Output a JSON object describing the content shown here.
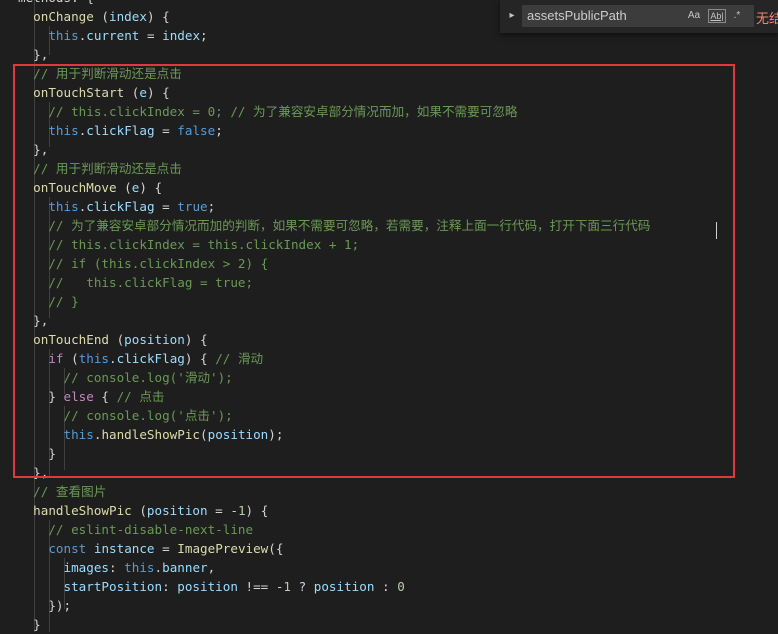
{
  "find_widget": {
    "query": "assetsPublicPath",
    "toggle_icon": "chevron-right-icon",
    "match_case_label": "Aa",
    "whole_word_label": "Ab|",
    "regex_label": ".*",
    "results_text": "无结"
  },
  "colors": {
    "background": "#1e1e1e",
    "highlight_border": "#e0383e",
    "keyword": "#569cd6",
    "function": "#dcdcaa",
    "variable": "#9cdcfe",
    "comment": "#6a9955",
    "string": "#ce9178",
    "number": "#b5cea8"
  },
  "code_lines": [
    [
      [
        "methods: {",
        "pun"
      ]
    ],
    [
      [
        "  ",
        "pun"
      ],
      [
        "onChange",
        "fn"
      ],
      [
        " (",
        "pun"
      ],
      [
        "index",
        "var"
      ],
      [
        ") {",
        "pun"
      ]
    ],
    [
      [
        "    ",
        "pun"
      ],
      [
        "this",
        "kw"
      ],
      [
        ".",
        "pun"
      ],
      [
        "current",
        "prop"
      ],
      [
        " = ",
        "pun"
      ],
      [
        "index",
        "var"
      ],
      [
        ";",
        "pun"
      ]
    ],
    [
      [
        "  },",
        "pun"
      ]
    ],
    [
      [
        "  ",
        "pun"
      ],
      [
        "// 用于判断滑动还是点击",
        "cm"
      ]
    ],
    [
      [
        "  ",
        "pun"
      ],
      [
        "onTouchStart",
        "fn"
      ],
      [
        " (",
        "pun"
      ],
      [
        "e",
        "var"
      ],
      [
        ") {",
        "pun"
      ]
    ],
    [
      [
        "    ",
        "pun"
      ],
      [
        "// this.clickIndex = 0; // 为了兼容安卓部分情况而加，如果不需要可忽略",
        "cm"
      ]
    ],
    [
      [
        "    ",
        "pun"
      ],
      [
        "this",
        "kw"
      ],
      [
        ".",
        "pun"
      ],
      [
        "clickFlag",
        "prop"
      ],
      [
        " = ",
        "pun"
      ],
      [
        "false",
        "kw"
      ],
      [
        ";",
        "pun"
      ]
    ],
    [
      [
        "  },",
        "pun"
      ]
    ],
    [
      [
        "  ",
        "pun"
      ],
      [
        "// 用于判断滑动还是点击",
        "cm"
      ]
    ],
    [
      [
        "  ",
        "pun"
      ],
      [
        "onTouchMove",
        "fn"
      ],
      [
        " (",
        "pun"
      ],
      [
        "e",
        "var"
      ],
      [
        ") {",
        "pun"
      ]
    ],
    [
      [
        "    ",
        "pun"
      ],
      [
        "this",
        "kw"
      ],
      [
        ".",
        "pun"
      ],
      [
        "clickFlag",
        "prop"
      ],
      [
        " = ",
        "pun"
      ],
      [
        "true",
        "kw"
      ],
      [
        ";",
        "pun"
      ]
    ],
    [
      [
        "    ",
        "pun"
      ],
      [
        "// 为了兼容安卓部分情况而加的判断，如果不需要可忽略，若需要，注释上面一行代码，打开下面三行代码",
        "cm"
      ]
    ],
    [
      [
        "    ",
        "pun"
      ],
      [
        "// this.clickIndex = this.clickIndex + 1;",
        "cm"
      ]
    ],
    [
      [
        "    ",
        "pun"
      ],
      [
        "// if (this.clickIndex > 2) {",
        "cm"
      ]
    ],
    [
      [
        "    ",
        "pun"
      ],
      [
        "//   this.clickFlag = true;",
        "cm"
      ]
    ],
    [
      [
        "    ",
        "pun"
      ],
      [
        "// }",
        "cm"
      ]
    ],
    [
      [
        "  },",
        "pun"
      ]
    ],
    [
      [
        "  ",
        "pun"
      ],
      [
        "onTouchEnd",
        "fn"
      ],
      [
        " (",
        "pun"
      ],
      [
        "position",
        "var"
      ],
      [
        ") {",
        "pun"
      ]
    ],
    [
      [
        "    ",
        "pun"
      ],
      [
        "if",
        "ctl"
      ],
      [
        " (",
        "pun"
      ],
      [
        "this",
        "kw"
      ],
      [
        ".",
        "pun"
      ],
      [
        "clickFlag",
        "prop"
      ],
      [
        ") { ",
        "pun"
      ],
      [
        "// 滑动",
        "cm"
      ]
    ],
    [
      [
        "      ",
        "pun"
      ],
      [
        "// console.log('滑动');",
        "cm"
      ]
    ],
    [
      [
        "    } ",
        "pun"
      ],
      [
        "else",
        "ctl"
      ],
      [
        " { ",
        "pun"
      ],
      [
        "// 点击",
        "cm"
      ]
    ],
    [
      [
        "      ",
        "pun"
      ],
      [
        "// console.log('点击');",
        "cm"
      ]
    ],
    [
      [
        "      ",
        "pun"
      ],
      [
        "this",
        "kw"
      ],
      [
        ".",
        "pun"
      ],
      [
        "handleShowPic",
        "fn"
      ],
      [
        "(",
        "pun"
      ],
      [
        "position",
        "var"
      ],
      [
        ");",
        "pun"
      ]
    ],
    [
      [
        "    }",
        "pun"
      ]
    ],
    [
      [
        "  },",
        "pun"
      ]
    ],
    [
      [
        "  ",
        "pun"
      ],
      [
        "// 查看图片",
        "cm"
      ]
    ],
    [
      [
        "  ",
        "pun"
      ],
      [
        "handleShowPic",
        "fn"
      ],
      [
        " (",
        "pun"
      ],
      [
        "position",
        "var"
      ],
      [
        " = -",
        "pun"
      ],
      [
        "1",
        "num"
      ],
      [
        ") {",
        "pun"
      ]
    ],
    [
      [
        "    ",
        "pun"
      ],
      [
        "// eslint-disable-next-line",
        "cm"
      ]
    ],
    [
      [
        "    ",
        "pun"
      ],
      [
        "const",
        "kw"
      ],
      [
        " ",
        "pun"
      ],
      [
        "instance",
        "var"
      ],
      [
        " = ",
        "pun"
      ],
      [
        "ImagePreview",
        "fn"
      ],
      [
        "({",
        "pun"
      ]
    ],
    [
      [
        "      ",
        "pun"
      ],
      [
        "images",
        "prop"
      ],
      [
        ": ",
        "pun"
      ],
      [
        "this",
        "kw"
      ],
      [
        ".",
        "pun"
      ],
      [
        "banner",
        "prop"
      ],
      [
        ",",
        "pun"
      ]
    ],
    [
      [
        "      ",
        "pun"
      ],
      [
        "startPosition",
        "prop"
      ],
      [
        ": ",
        "pun"
      ],
      [
        "position",
        "var"
      ],
      [
        " !== -",
        "pun"
      ],
      [
        "1",
        "num"
      ],
      [
        " ? ",
        "pun"
      ],
      [
        "position",
        "var"
      ],
      [
        " : ",
        "pun"
      ],
      [
        "0",
        "num"
      ]
    ],
    [
      [
        "    });",
        "pun"
      ]
    ],
    [
      [
        "  }",
        "pun"
      ]
    ]
  ]
}
